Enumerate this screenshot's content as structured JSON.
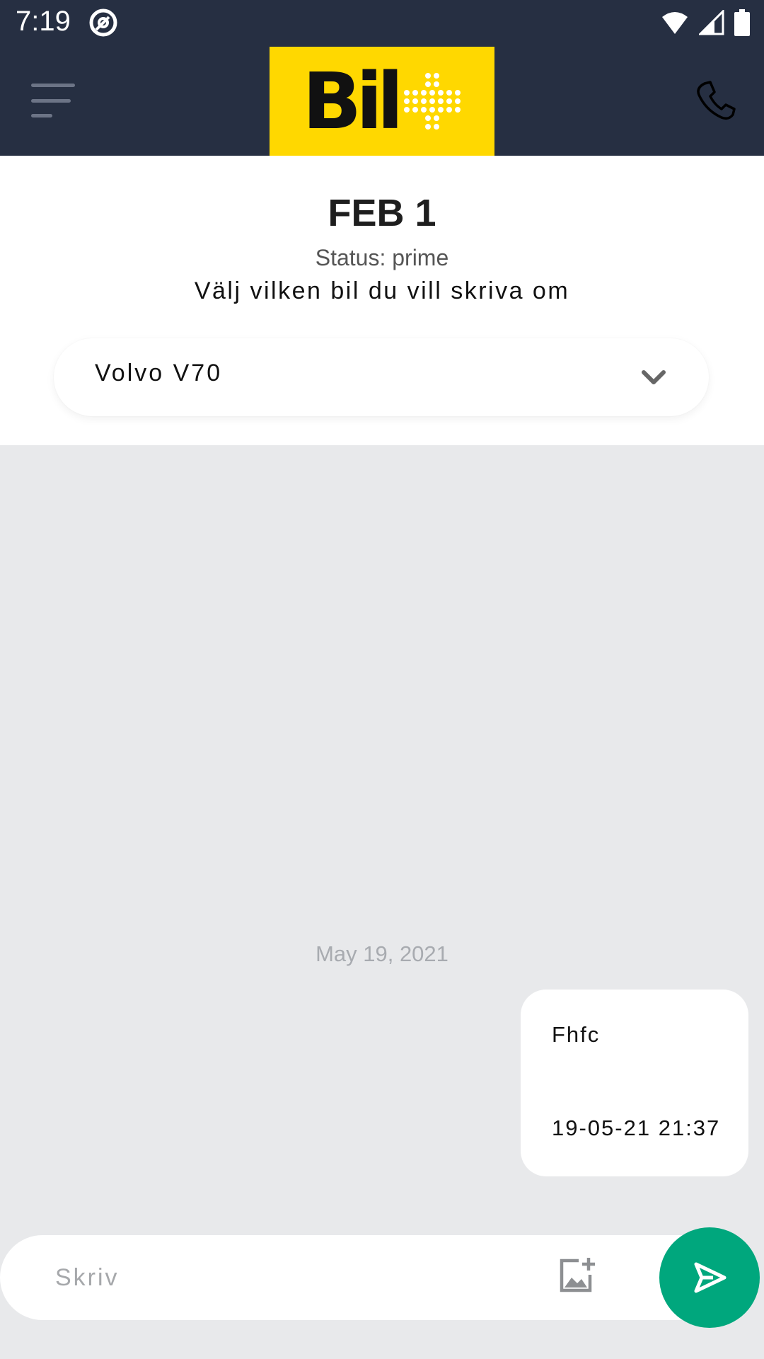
{
  "status_bar": {
    "time": "7:19"
  },
  "header": {
    "logo_text": "Bil"
  },
  "info": {
    "title": "FEB 1",
    "status": "Status: prime",
    "prompt": "Välj vilken bil du vill skriva om",
    "car_select": {
      "selected": "Volvo V70"
    }
  },
  "chat": {
    "date_separator": "May 19, 2021",
    "messages": [
      {
        "text": "Fhfc",
        "timestamp": "19-05-21 21:37"
      }
    ]
  },
  "composer": {
    "placeholder": "Skriv",
    "value": ""
  },
  "colors": {
    "header_bg": "#262f42",
    "logo_bg": "#ffd800",
    "send_button": "#00a77d",
    "chat_bg": "#e8e9eb"
  }
}
